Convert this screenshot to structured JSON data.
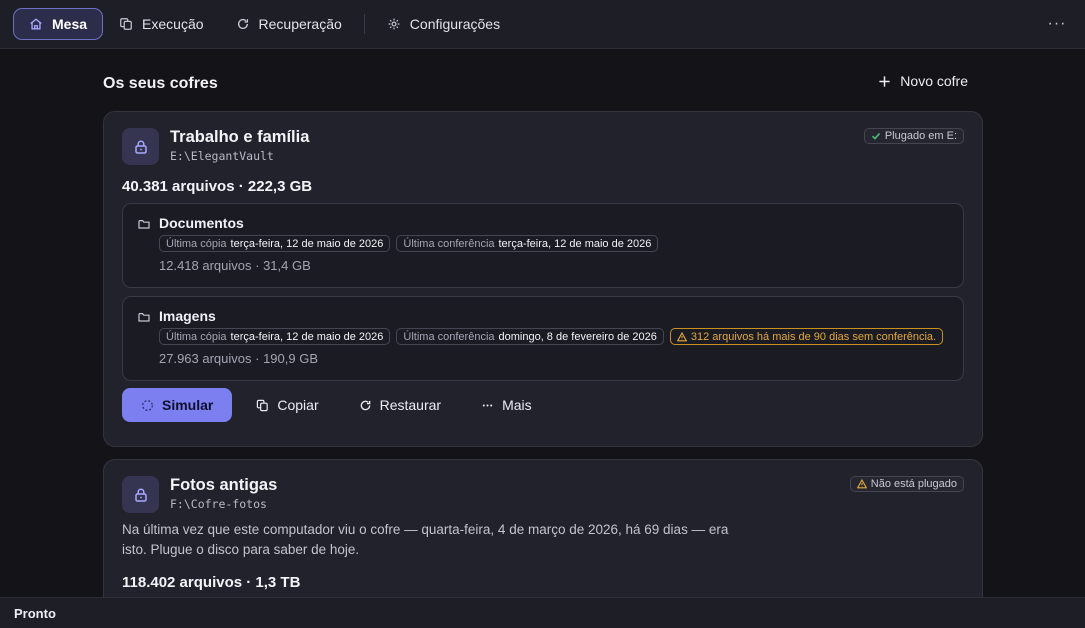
{
  "nav": {
    "items": [
      {
        "label": "Mesa",
        "icon": "home-icon",
        "active": true
      },
      {
        "label": "Execução",
        "icon": "copy-icon",
        "active": false
      },
      {
        "label": "Recuperação",
        "icon": "refresh-icon",
        "active": false
      },
      {
        "label": "Configurações",
        "icon": "gear-icon",
        "active": false
      }
    ],
    "more_label": "···"
  },
  "section": {
    "title": "Os seus cofres",
    "new_vault_label": "Novo cofre"
  },
  "vaults": [
    {
      "name": "Trabalho e família",
      "path": "E:\\ElegantVault",
      "badge": "Plugado em E:",
      "totals": "40.381 arquivos · 222,3 GB",
      "folders": [
        {
          "name": "Documentos",
          "chips": [
            {
              "label": "Última cópia",
              "value": "terça-feira, 12 de maio de 2026"
            },
            {
              "label": "Última conferência",
              "value": "terça-feira, 12 de maio de 2026"
            }
          ],
          "meta": "12.418 arquivos · 31,4 GB"
        },
        {
          "name": "Imagens",
          "chips": [
            {
              "label": "Última cópia",
              "value": "terça-feira, 12 de maio de 2026"
            },
            {
              "label": "Última conferência",
              "value": "domingo, 8 de fevereiro de 2026"
            }
          ],
          "warning": "312 arquivos há mais de 90 dias sem conferência.",
          "meta": "27.963 arquivos · 190,9 GB"
        }
      ],
      "actions": {
        "simulate": "Simular",
        "copy": "Copiar",
        "restore": "Restaurar",
        "more": "Mais"
      }
    },
    {
      "name": "Fotos antigas",
      "path": "F:\\Cofre-fotos",
      "badge": "Não está plugado",
      "note": "Na última vez que este computador viu o cofre — quarta-feira, 4 de março de 2026, há 69 dias — era isto. Plugue o disco para saber de hoje.",
      "totals": "118.402 arquivos · 1,3 TB"
    }
  ],
  "status": {
    "text": "Pronto"
  },
  "colors": {
    "accent": "#7b7ff0",
    "ok": "#4fc27a",
    "warning": "#e2a93b"
  }
}
